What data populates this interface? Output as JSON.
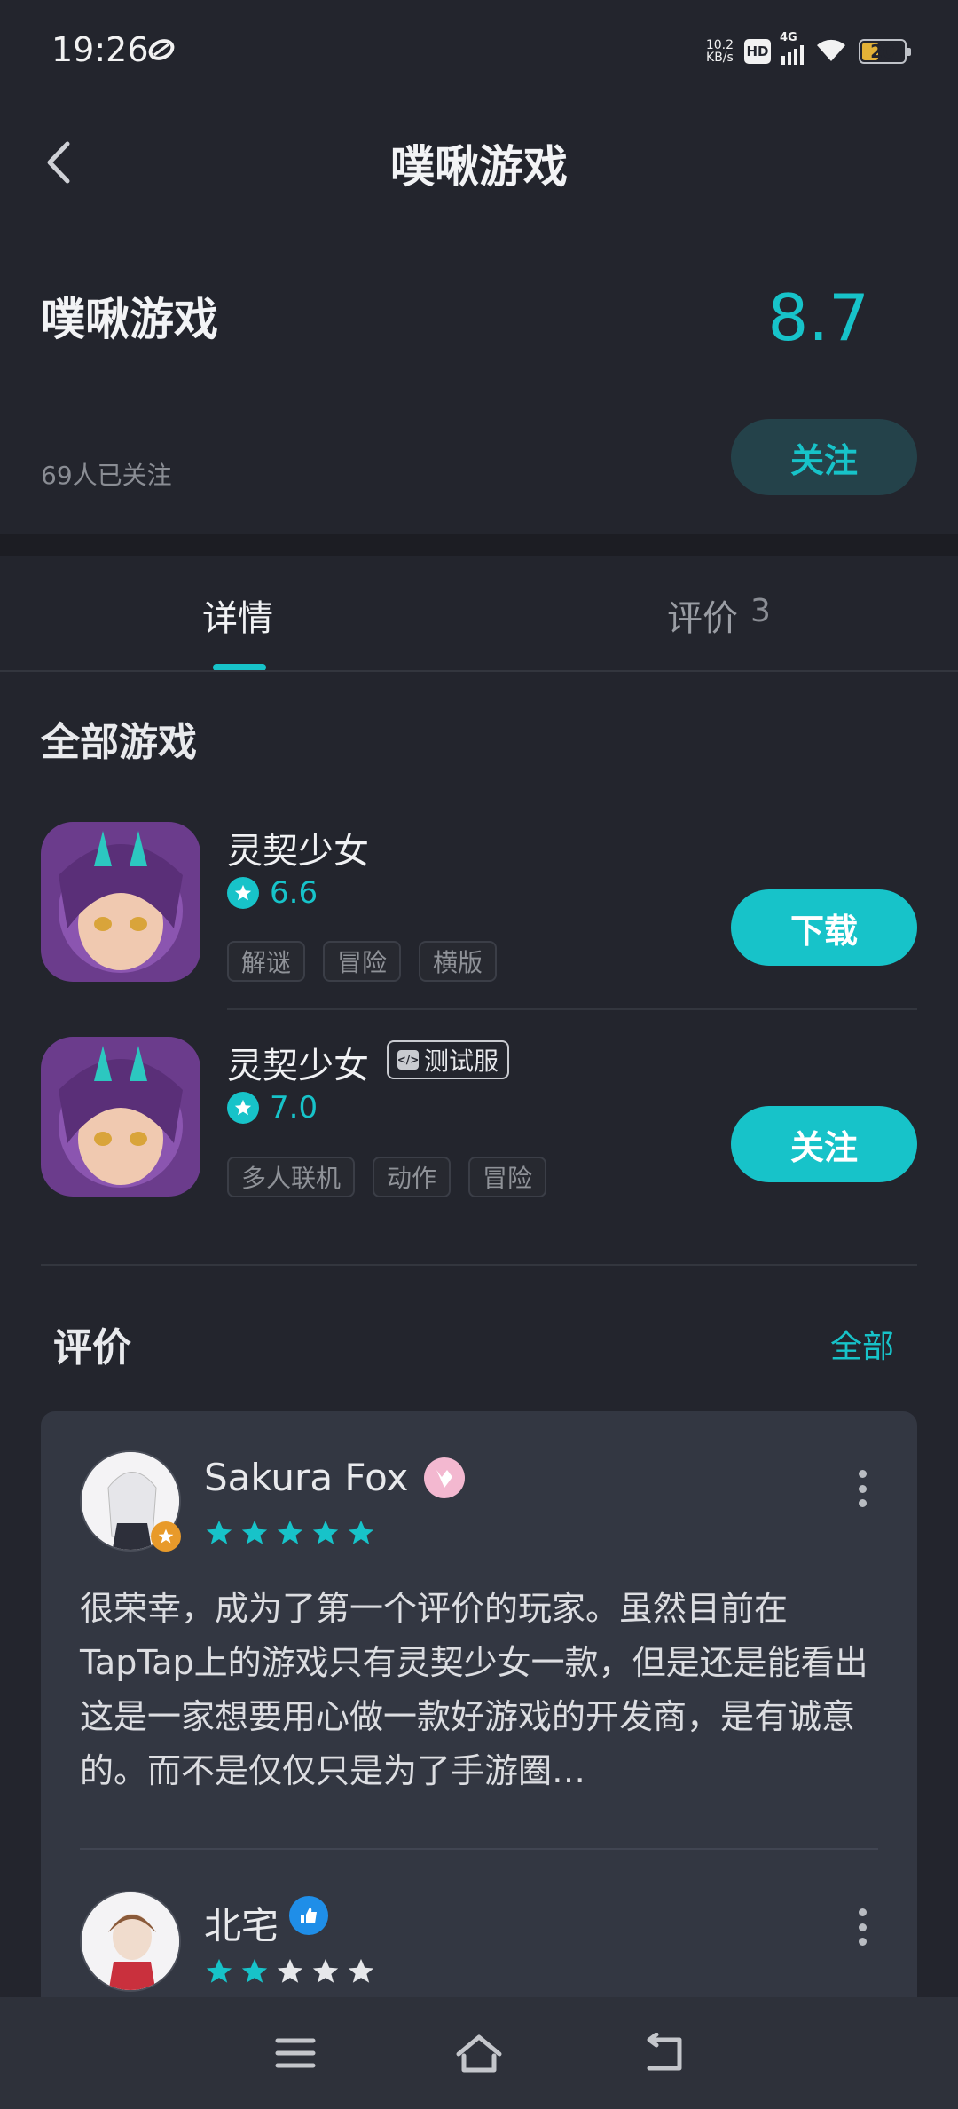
{
  "status_bar": {
    "time": "19:26",
    "net_speed_value": "10.2",
    "net_speed_unit": "KB/s",
    "hd": "HD",
    "network": "4G",
    "battery": "20"
  },
  "header": {
    "title": "噗啾游戏"
  },
  "developer": {
    "name": "噗啾游戏",
    "score": "8.7",
    "followers": "69人已关注",
    "follow_label": "关注"
  },
  "tabs": [
    {
      "label": "详情"
    },
    {
      "label": "评价",
      "count": "3"
    }
  ],
  "games_section": {
    "title": "全部游戏",
    "games": [
      {
        "name": "灵契少女",
        "rating": "6.6",
        "badge": "",
        "tags": [
          "解谜",
          "冒险",
          "横版"
        ],
        "action": "下载"
      },
      {
        "name": "灵契少女",
        "rating": "7.0",
        "badge": "测试服",
        "tags": [
          "多人联机",
          "动作",
          "冒险"
        ],
        "action": "关注"
      }
    ]
  },
  "reviews_section": {
    "title": "评价",
    "all_label": "全部",
    "reviews": [
      {
        "name": "Sakura Fox",
        "stars": 5,
        "text": "很荣幸，成为了第一个评价的玩家。虽然目前在TapTap上的游戏只有灵契少女一款，但是还是能看出这是一家想要用心做一款好游戏的开发商，是有诚意的。而不是仅仅只是为了手游圈…"
      },
      {
        "name": "北宅",
        "stars": 2,
        "text": ""
      }
    ]
  },
  "colors": {
    "accent": "#17c3c9",
    "background": "#23252d",
    "card": "#333742"
  },
  "icons": {
    "back": "chevron-left-icon",
    "menu": "menu-icon",
    "home": "home-icon",
    "return": "back-icon"
  }
}
